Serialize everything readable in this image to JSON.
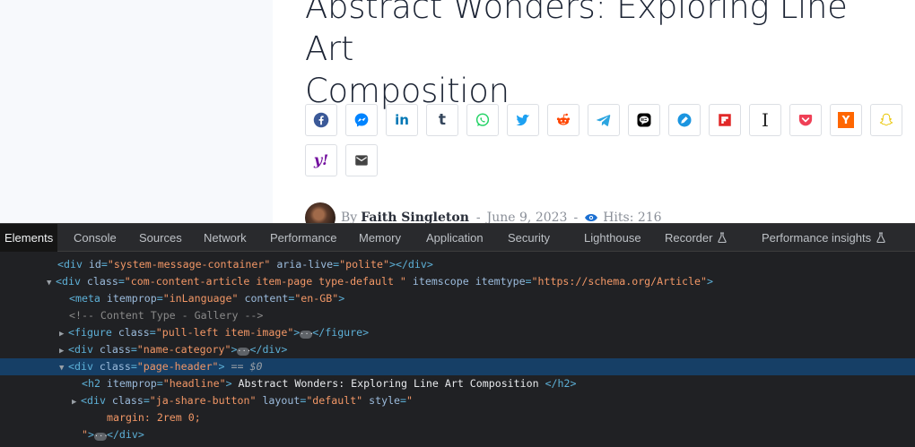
{
  "article": {
    "title_line1": "Abstract Wonders: Exploring Line Art",
    "title_line2": "Composition",
    "share_buttons": [
      {
        "name": "facebook",
        "icon": "facebook-icon",
        "color": "#3b5998"
      },
      {
        "name": "messenger",
        "icon": "messenger-icon",
        "color": "#0084ff"
      },
      {
        "name": "linkedin",
        "icon": "linkedin-icon",
        "color": "#0077b5",
        "label": "in"
      },
      {
        "name": "tumblr",
        "icon": "tumblr-icon",
        "color": "#35465c",
        "label": "t"
      },
      {
        "name": "whatsapp",
        "icon": "whatsapp-icon",
        "color": "#25d366"
      },
      {
        "name": "twitter",
        "icon": "twitter-icon",
        "color": "#1da1f2"
      },
      {
        "name": "reddit",
        "icon": "reddit-icon",
        "color": "#ff4500"
      },
      {
        "name": "telegram",
        "icon": "telegram-icon",
        "color": "#2ca5e0"
      },
      {
        "name": "line",
        "icon": "line-icon",
        "color": "#000000"
      },
      {
        "name": "bluesky",
        "icon": "pen-icon",
        "color": "#1b95e0"
      },
      {
        "name": "flipboard",
        "icon": "flipboard-icon",
        "color": "#e12828"
      },
      {
        "name": "instapaper",
        "icon": "instapaper-icon",
        "color": "#1f1f1f",
        "label": "I"
      },
      {
        "name": "pocket",
        "icon": "pocket-icon",
        "color": "#ef4056"
      },
      {
        "name": "hackernews",
        "icon": "hackernews-icon",
        "color": "#ff6600",
        "label": "Y"
      },
      {
        "name": "snapchat",
        "icon": "snapchat-icon",
        "color": "#fffc00"
      },
      {
        "name": "yahoo",
        "icon": "yahoo-icon",
        "color": "#720e9e",
        "label": "y!"
      },
      {
        "name": "email",
        "icon": "email-icon",
        "color": "#444444"
      }
    ],
    "meta": {
      "by": "By",
      "author": "Faith Singleton",
      "sep": "-",
      "date": "June 9, 2023",
      "hits": "Hits: 216"
    }
  },
  "devtools": {
    "tabs": [
      {
        "label": "Elements",
        "active": true
      },
      {
        "label": "Console"
      },
      {
        "label": "Sources"
      },
      {
        "label": "Network"
      },
      {
        "label": "Performance"
      },
      {
        "label": "Memory"
      },
      {
        "label": "Application"
      },
      {
        "label": "Security"
      },
      {
        "label": "Lighthouse"
      },
      {
        "label": "Recorder",
        "flask": true
      },
      {
        "label": "Performance insights",
        "flask": true
      }
    ],
    "colors": {
      "panel_bg": "#202124",
      "tag": "#5db0d7",
      "attr_name": "#9bbbdc",
      "attr_value": "#f29766",
      "selected_bg": "#163f66"
    },
    "dom": {
      "l1": {
        "tag_open": "<div ",
        "a1": "id",
        "v1": "\"system-message-container\"",
        "a2": "aria-live",
        "v2": "\"polite\"",
        "close": "></div>"
      },
      "l2": {
        "tag_open": "<div ",
        "a1": "class",
        "v1": "\"com-content-article item-page type-default \"",
        "a2": "itemscope",
        "a3": "itemtype",
        "v3": "\"https://schema.org/Article\"",
        "close": ">"
      },
      "l3": {
        "tag_open": "<meta ",
        "a1": "itemprop",
        "v1": "\"inLanguage\"",
        "a2": "content",
        "v2": "\"en-GB\"",
        "close": ">"
      },
      "l4": {
        "comment": "<!-- Content Type - Gallery -->"
      },
      "l5": {
        "tag_open": "<figure ",
        "a1": "class",
        "v1": "\"pull-left item-image\"",
        "close_a": ">",
        "close_b": "</figure>"
      },
      "l6": {
        "tag_open": "<div ",
        "a1": "class",
        "v1": "\"name-category\"",
        "close_a": ">",
        "close_b": "</div>"
      },
      "l7": {
        "tag_open": "<div ",
        "a1": "class",
        "v1": "\"page-header\"",
        "close": ">",
        "eq": "==",
        "dollar": "$0"
      },
      "l8": {
        "tag_open": "<h2 ",
        "a1": "itemprop",
        "v1": "\"headline\"",
        "close": ">",
        "text": "Abstract Wonders: Exploring Line Art Composition",
        "end": "</h2>"
      },
      "l9": {
        "tag_open": "<div ",
        "a1": "class",
        "v1": "\"ja-share-button\"",
        "a2": "layout",
        "v2": "\"default\"",
        "a3": "style",
        "v3": "\""
      },
      "l10": {
        "style_text": "margin: 2rem 0;"
      },
      "l11": {
        "quote": "\"",
        "close_a": ">",
        "close_b": "</div>"
      }
    }
  }
}
